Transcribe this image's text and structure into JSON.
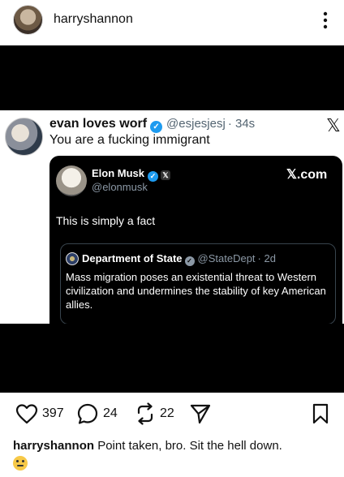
{
  "post": {
    "username": "harryshannon",
    "likes": "397",
    "comments": "24",
    "reposts": "22",
    "caption_user": "harryshannon",
    "caption_text": " Point taken, bro. Sit the hell down."
  },
  "tweet": {
    "name": "evan loves worf",
    "handle": "@esjesjesj",
    "time": "· 34s",
    "text": "You are a fucking immigrant",
    "x_logo": "𝕏"
  },
  "card": {
    "name": "Elon Musk",
    "x_badge": "𝕏",
    "handle": "@elonmusk",
    "brand": "𝕏.com",
    "text": "This is simply a fact",
    "quote": {
      "name": "Department of State",
      "handle": "@StateDept",
      "time": "· 2d",
      "text": "Mass migration poses an existential threat to Western civilization and undermines the stability of key American allies."
    }
  },
  "icons": {
    "verified_color": "#1d9bf0",
    "verified_glyph": "✓"
  }
}
